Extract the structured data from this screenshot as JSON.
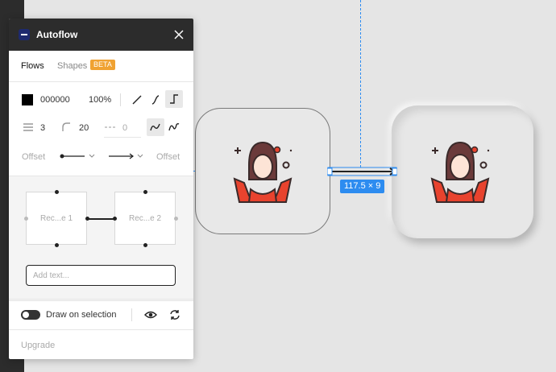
{
  "panel": {
    "title": "Autoflow",
    "tabs": {
      "flows": "Flows",
      "shapes": "Shapes",
      "beta_badge": "BETA"
    },
    "stroke": {
      "color_hex": "000000",
      "opacity": "100%",
      "weight": "3",
      "corner_radius": "20",
      "dash": "0"
    },
    "offsets": {
      "start_label": "Offset",
      "end_label": "Offset"
    },
    "preview": {
      "node_a": "Rec...e 1",
      "node_b": "Rec...e 2"
    },
    "text_input_placeholder": "Add text...",
    "draw_on_selection_label": "Draw on selection",
    "upgrade_label": "Upgrade"
  },
  "canvas": {
    "measurement_label": "117.5 × 9"
  },
  "colors": {
    "accent": "#2d8cf0",
    "beta": "#f0a232",
    "titlebar": "#2c2c2c",
    "figure_red": "#e8432e",
    "figure_hair": "#6b3a3a"
  }
}
